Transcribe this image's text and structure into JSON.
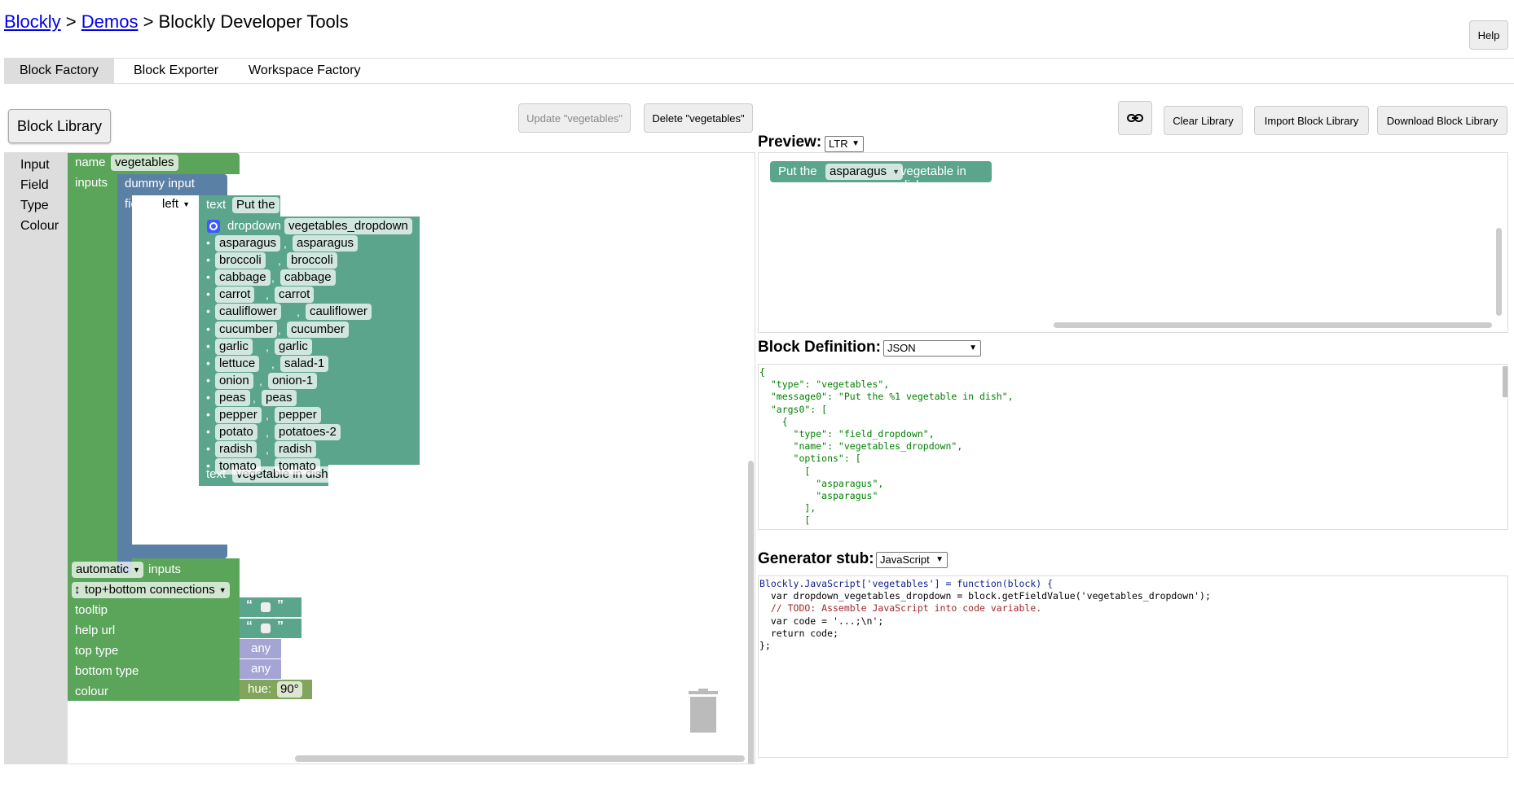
{
  "breadcrumb": {
    "link1": "Blockly",
    "sep1": " > ",
    "link2": "Demos",
    "sep2": " > ",
    "title": "Blockly Developer Tools"
  },
  "help_button": "Help",
  "tabs": [
    "Block Factory",
    "Block Exporter",
    "Workspace Factory"
  ],
  "toolbar": {
    "block_library": "Block Library",
    "update": "Update \"vegetables\"",
    "delete": "Delete \"vegetables\"",
    "clear_library": "Clear Library",
    "import_library": "Import Block Library",
    "download_library": "Download Block Library"
  },
  "toolbox": [
    "Input",
    "Field",
    "Type",
    "Colour"
  ],
  "factory_block": {
    "name_label": "name",
    "name_value": "vegetables",
    "inputs_label": "inputs",
    "dummy_input": "dummy input",
    "fields_label": "fields",
    "align_value": "left",
    "text1_label": "text",
    "text1_value": "Put the",
    "dropdown_label": "dropdown",
    "dropdown_name": "vegetables_dropdown",
    "options": [
      [
        "asparagus",
        "asparagus"
      ],
      [
        "broccoli",
        "broccoli"
      ],
      [
        "cabbage",
        "cabbage"
      ],
      [
        "carrot",
        "carrot"
      ],
      [
        "cauliflower",
        "cauliflower"
      ],
      [
        "cucumber",
        "cucumber"
      ],
      [
        "garlic",
        "garlic"
      ],
      [
        "lettuce",
        "salad-1"
      ],
      [
        "onion",
        "onion-1"
      ],
      [
        "peas",
        "peas"
      ],
      [
        "pepper",
        "pepper"
      ],
      [
        "potato",
        "potatoes-2"
      ],
      [
        "radish",
        "radish"
      ],
      [
        "tomato",
        "tomato"
      ]
    ],
    "text2_label": "text",
    "text2_value": "vegetable in dish",
    "automatic": "automatic",
    "inputs_word": "inputs",
    "connections": "top+bottom connections",
    "tooltip": "tooltip",
    "help_url": "help url",
    "top_type": "top type",
    "bottom_type": "bottom type",
    "colour": "colour",
    "any": "any",
    "hue_label": "hue:",
    "hue_value": "90°"
  },
  "preview": {
    "heading": "Preview:",
    "direction": "LTR",
    "block_text1": "Put the",
    "block_dropdown": "asparagus",
    "block_text2": "vegetable in dish"
  },
  "block_definition": {
    "heading": "Block Definition:",
    "format": "JSON",
    "code": "{\n  \"type\": \"vegetables\",\n  \"message0\": \"Put the %1 vegetable in dish\",\n  \"args0\": [\n    {\n      \"type\": \"field_dropdown\",\n      \"name\": \"vegetables_dropdown\",\n      \"options\": [\n        [\n          \"asparagus\",\n          \"asparagus\"\n        ],\n        [\n          \"broccoli\","
  },
  "generator": {
    "heading": "Generator stub:",
    "language": "JavaScript",
    "code": "Blockly.JavaScript['vegetables'] = function(block) {\n  var dropdown_vegetables_dropdown = block.getFieldValue('vegetables_dropdown');\n  // TODO: Assemble JavaScript into code variable.\n  var code = '...;\\n';\n  return code;\n};"
  },
  "colors": {
    "factory_green": "#5ba55b",
    "input_blue": "#5b80a5",
    "field_teal": "#5ba58c",
    "type_lavender": "#a5a5d5",
    "colour_olive": "#80a55b"
  }
}
